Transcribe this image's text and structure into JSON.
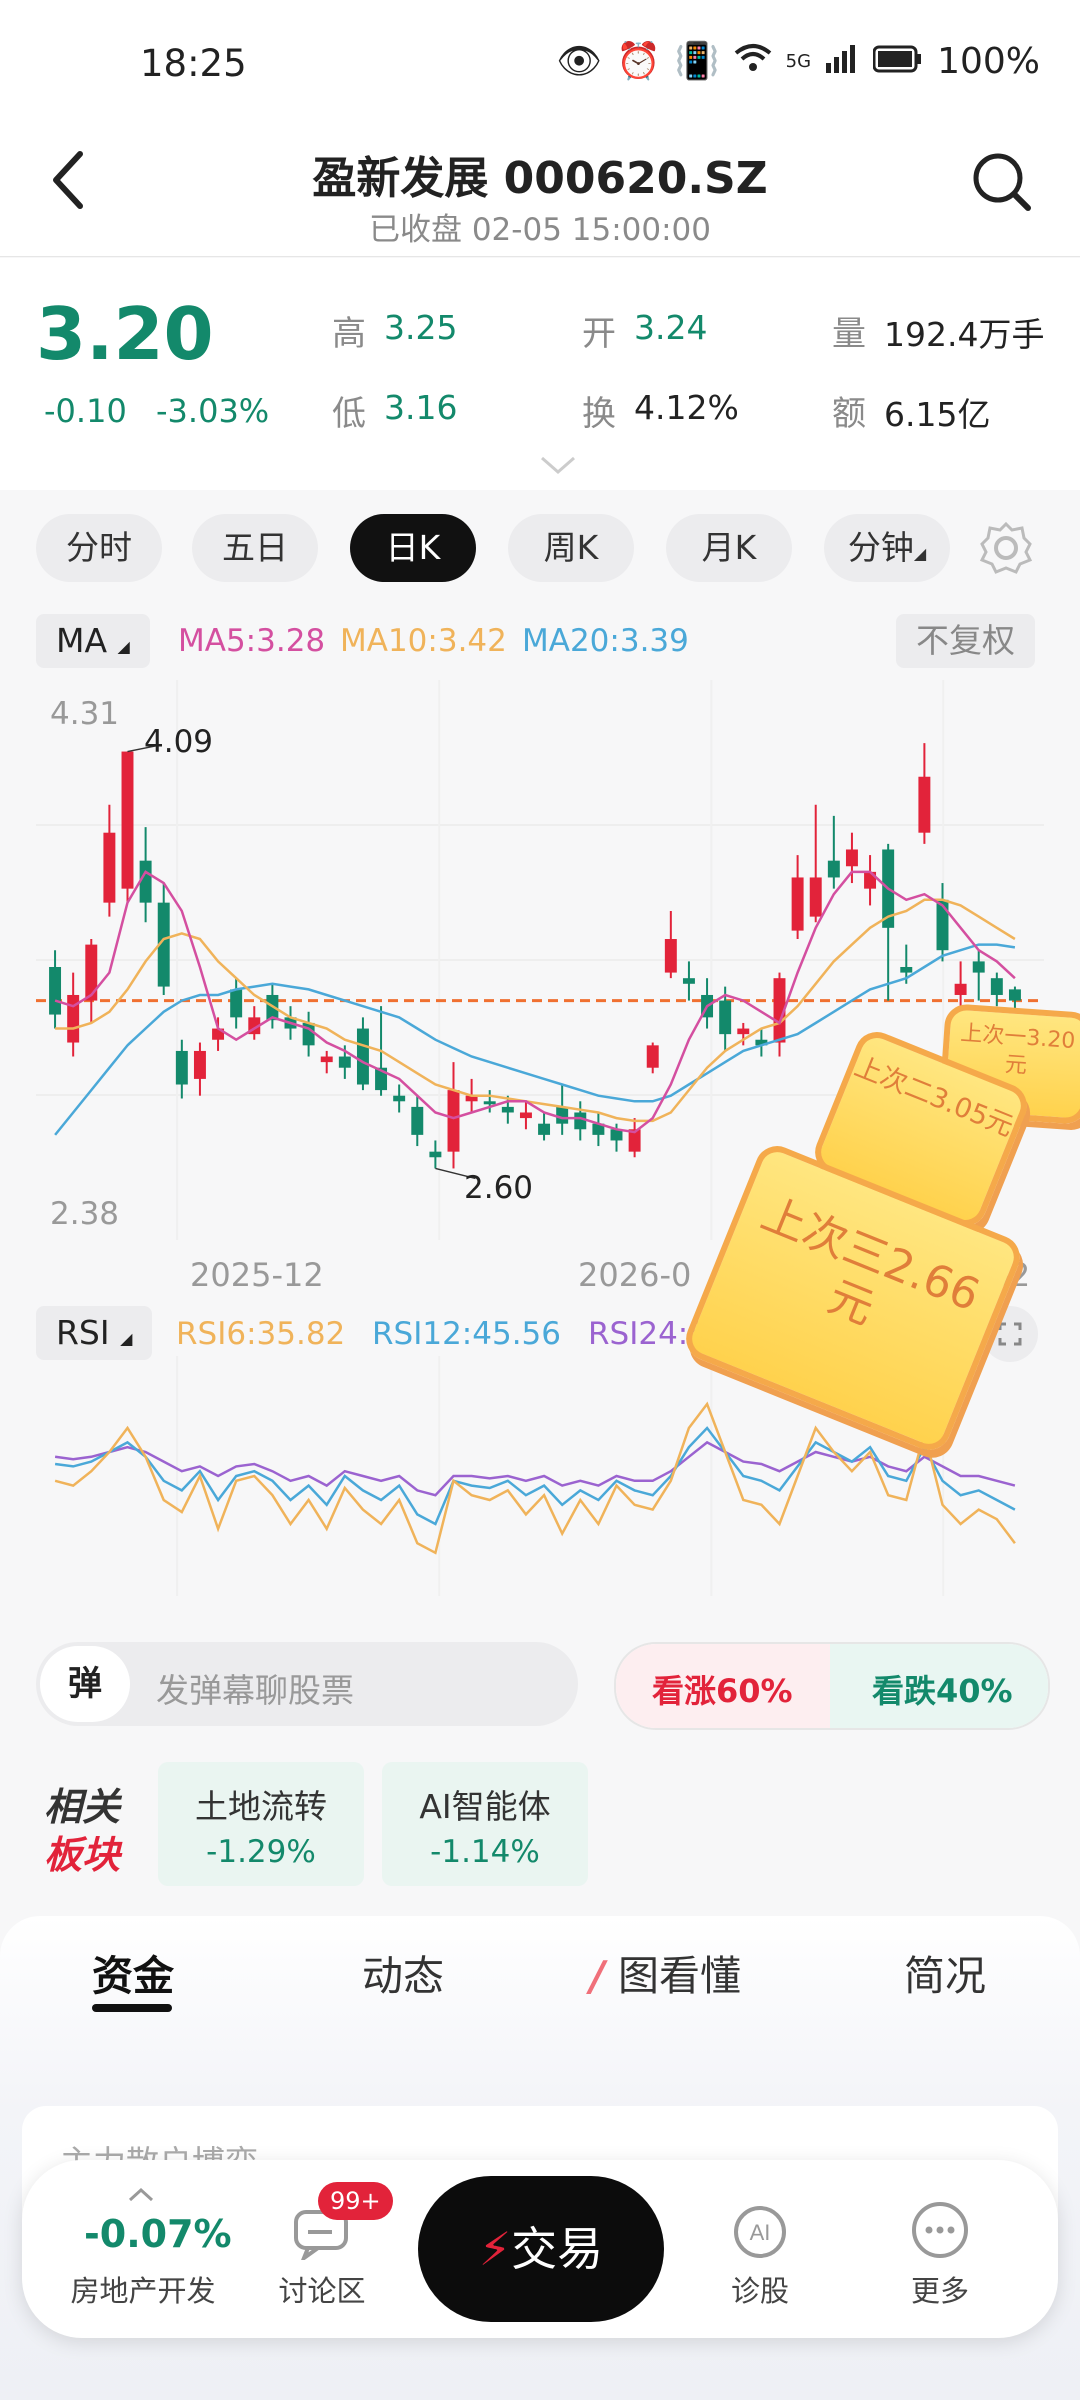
{
  "status": {
    "time": "18:25",
    "network": "5G",
    "battery": "100%"
  },
  "header": {
    "title": "盈新发展 000620.SZ",
    "subtitle": "已收盘 02-05 15:00:00"
  },
  "quote": {
    "price": "3.20",
    "change": "-0.10",
    "change_pct": "-3.03%",
    "high_label": "高",
    "high": "3.25",
    "low_label": "低",
    "low": "3.16",
    "open_label": "开",
    "open": "3.24",
    "turnover_label": "换",
    "turnover": "4.12%",
    "volume_label": "量",
    "volume": "192.4万手",
    "amount_label": "额",
    "amount": "6.15亿"
  },
  "periods": [
    {
      "label": "分时"
    },
    {
      "label": "五日"
    },
    {
      "label": "日K"
    },
    {
      "label": "周K"
    },
    {
      "label": "月K"
    },
    {
      "label": "分钟"
    }
  ],
  "ma": {
    "label": "MA",
    "ma5": "MA5:3.28",
    "ma10": "MA10:3.42",
    "ma20": "MA20:3.39",
    "adjust": "不复权"
  },
  "chart_labels": {
    "top": "4.31",
    "bottom": "2.38",
    "max": "4.09",
    "min": "2.60",
    "x1": "2025-12",
    "x2": "2026-0",
    "x3": "-02"
  },
  "rsi": {
    "label": "RSI",
    "rsi6": "RSI6:35.82",
    "rsi12": "RSI12:45.56",
    "rsi24": "RSI24:50."
  },
  "tags": {
    "t1": "上次一3.20元",
    "t2": "上次二3.05元",
    "t3": "上次三2.66元"
  },
  "danmu": {
    "toggle": "弹",
    "placeholder": "发弹幕聊股票"
  },
  "vote": {
    "up_label": "看涨",
    "up_pct": "60%",
    "down_label": "看跌",
    "down_pct": "40%"
  },
  "sectors": {
    "title_top": "相关",
    "title_bottom": "板块",
    "items": [
      {
        "name": "土地流转",
        "change": "-1.29%"
      },
      {
        "name": "AI智能体",
        "change": "-1.14%"
      }
    ]
  },
  "tabs": [
    {
      "label": "资金"
    },
    {
      "label": "动态"
    },
    {
      "label": "图看懂"
    },
    {
      "label": "简况"
    }
  ],
  "card": {
    "title": "主力散户博弈"
  },
  "nav": {
    "index_value": "-0.07%",
    "index_name": "房地产开发",
    "forum": "讨论区",
    "badge": "99+",
    "trade": "交易",
    "diagnose": "诊股",
    "more": "更多"
  },
  "colors": {
    "green": "#13896b",
    "red": "#e2233a",
    "ma5": "#d44fa0",
    "ma10": "#f0b35a",
    "ma20": "#4aa8d8",
    "rsi6": "#f0b35a",
    "rsi12": "#4aa8d8",
    "rsi24": "#9b63d0"
  },
  "chart_data": {
    "type": "candlestick",
    "ylim": [
      2.38,
      4.31
    ],
    "last_close": 3.2,
    "annotations": [
      "4.09",
      "2.60"
    ],
    "candles": [
      {
        "o": 3.32,
        "c": 3.15,
        "h": 3.38,
        "l": 3.1
      },
      {
        "o": 3.05,
        "c": 3.22,
        "h": 3.3,
        "l": 3.0
      },
      {
        "o": 3.2,
        "c": 3.4,
        "h": 3.42,
        "l": 3.12
      },
      {
        "o": 3.55,
        "c": 3.8,
        "h": 3.9,
        "l": 3.5
      },
      {
        "o": 3.6,
        "c": 4.09,
        "h": 4.09,
        "l": 3.55
      },
      {
        "o": 3.7,
        "c": 3.55,
        "h": 3.82,
        "l": 3.48
      },
      {
        "o": 3.55,
        "c": 3.25,
        "h": 3.62,
        "l": 3.22
      },
      {
        "o": 3.02,
        "c": 2.9,
        "h": 3.06,
        "l": 2.85
      },
      {
        "o": 2.92,
        "c": 3.02,
        "h": 3.05,
        "l": 2.86
      },
      {
        "o": 3.06,
        "c": 3.1,
        "h": 3.14,
        "l": 3.02
      },
      {
        "o": 3.24,
        "c": 3.14,
        "h": 3.28,
        "l": 3.1
      },
      {
        "o": 3.08,
        "c": 3.14,
        "h": 3.18,
        "l": 3.06
      },
      {
        "o": 3.22,
        "c": 3.13,
        "h": 3.26,
        "l": 3.1
      },
      {
        "o": 3.14,
        "c": 3.1,
        "h": 3.18,
        "l": 3.06
      },
      {
        "o": 3.12,
        "c": 3.04,
        "h": 3.16,
        "l": 3.0
      },
      {
        "o": 2.98,
        "c": 3.0,
        "h": 3.02,
        "l": 2.94
      },
      {
        "o": 3.0,
        "c": 2.96,
        "h": 3.04,
        "l": 2.92
      },
      {
        "o": 3.1,
        "c": 2.9,
        "h": 3.14,
        "l": 2.88
      },
      {
        "o": 2.96,
        "c": 2.88,
        "h": 3.18,
        "l": 2.86
      },
      {
        "o": 2.86,
        "c": 2.84,
        "h": 2.9,
        "l": 2.8
      },
      {
        "o": 2.82,
        "c": 2.72,
        "h": 2.86,
        "l": 2.68
      },
      {
        "o": 2.66,
        "c": 2.64,
        "h": 2.7,
        "l": 2.6
      },
      {
        "o": 2.66,
        "c": 2.88,
        "h": 2.98,
        "l": 2.6
      },
      {
        "o": 2.84,
        "c": 2.86,
        "h": 2.92,
        "l": 2.8
      },
      {
        "o": 2.84,
        "c": 2.83,
        "h": 2.88,
        "l": 2.8
      },
      {
        "o": 2.82,
        "c": 2.8,
        "h": 2.86,
        "l": 2.76
      },
      {
        "o": 2.78,
        "c": 2.8,
        "h": 2.84,
        "l": 2.74
      },
      {
        "o": 2.76,
        "c": 2.72,
        "h": 2.8,
        "l": 2.7
      },
      {
        "o": 2.82,
        "c": 2.76,
        "h": 2.9,
        "l": 2.72
      },
      {
        "o": 2.8,
        "c": 2.74,
        "h": 2.84,
        "l": 2.7
      },
      {
        "o": 2.76,
        "c": 2.72,
        "h": 2.8,
        "l": 2.68
      },
      {
        "o": 2.74,
        "c": 2.7,
        "h": 2.76,
        "l": 2.66
      },
      {
        "o": 2.66,
        "c": 2.74,
        "h": 2.78,
        "l": 2.64
      },
      {
        "o": 2.96,
        "c": 3.04,
        "h": 3.05,
        "l": 2.94
      },
      {
        "o": 3.3,
        "c": 3.42,
        "h": 3.52,
        "l": 3.28
      },
      {
        "o": 3.28,
        "c": 3.26,
        "h": 3.34,
        "l": 3.2
      },
      {
        "o": 3.22,
        "c": 3.14,
        "h": 3.28,
        "l": 3.1
      },
      {
        "o": 3.2,
        "c": 3.08,
        "h": 3.25,
        "l": 3.02
      },
      {
        "o": 3.08,
        "c": 3.1,
        "h": 3.12,
        "l": 3.04
      },
      {
        "o": 3.06,
        "c": 3.04,
        "h": 3.1,
        "l": 3.0
      },
      {
        "o": 3.05,
        "c": 3.28,
        "h": 3.3,
        "l": 3.0
      },
      {
        "o": 3.45,
        "c": 3.64,
        "h": 3.72,
        "l": 3.42
      },
      {
        "o": 3.5,
        "c": 3.64,
        "h": 3.9,
        "l": 3.48
      },
      {
        "o": 3.7,
        "c": 3.64,
        "h": 3.86,
        "l": 3.6
      },
      {
        "o": 3.68,
        "c": 3.74,
        "h": 3.8,
        "l": 3.62
      },
      {
        "o": 3.6,
        "c": 3.66,
        "h": 3.72,
        "l": 3.54
      },
      {
        "o": 3.74,
        "c": 3.46,
        "h": 3.76,
        "l": 3.2
      },
      {
        "o": 3.32,
        "c": 3.3,
        "h": 3.4,
        "l": 3.26
      },
      {
        "o": 3.8,
        "c": 4.0,
        "h": 4.12,
        "l": 3.76
      },
      {
        "o": 3.56,
        "c": 3.38,
        "h": 3.62,
        "l": 3.34
      },
      {
        "o": 3.22,
        "c": 3.26,
        "h": 3.34,
        "l": 3.18
      },
      {
        "o": 3.34,
        "c": 3.3,
        "h": 3.38,
        "l": 3.2
      },
      {
        "o": 3.28,
        "c": 3.22,
        "h": 3.3,
        "l": 3.18
      },
      {
        "o": 3.24,
        "c": 3.2,
        "h": 3.25,
        "l": 3.16
      }
    ],
    "ma5": [
      3.2,
      3.18,
      3.22,
      3.3,
      3.55,
      3.66,
      3.62,
      3.52,
      3.32,
      3.1,
      3.06,
      3.1,
      3.14,
      3.12,
      3.1,
      3.05,
      3.02,
      2.98,
      2.95,
      2.92,
      2.86,
      2.8,
      2.78,
      2.8,
      2.82,
      2.84,
      2.84,
      2.8,
      2.78,
      2.78,
      2.76,
      2.74,
      2.73,
      2.78,
      2.9,
      3.06,
      3.18,
      3.22,
      3.2,
      3.16,
      3.12,
      3.3,
      3.46,
      3.58,
      3.66,
      3.66,
      3.6,
      3.56,
      3.58,
      3.54,
      3.46,
      3.38,
      3.34,
      3.28
    ],
    "ma10": [
      3.1,
      3.1,
      3.12,
      3.16,
      3.24,
      3.34,
      3.42,
      3.44,
      3.42,
      3.34,
      3.28,
      3.22,
      3.18,
      3.14,
      3.12,
      3.1,
      3.06,
      3.04,
      3.02,
      2.98,
      2.94,
      2.9,
      2.88,
      2.86,
      2.86,
      2.85,
      2.84,
      2.83,
      2.82,
      2.81,
      2.8,
      2.78,
      2.77,
      2.77,
      2.8,
      2.88,
      2.96,
      3.02,
      3.06,
      3.1,
      3.12,
      3.18,
      3.26,
      3.34,
      3.4,
      3.46,
      3.5,
      3.52,
      3.56,
      3.56,
      3.54,
      3.5,
      3.46,
      3.42
    ],
    "ma20": [
      2.72,
      2.8,
      2.88,
      2.96,
      3.04,
      3.1,
      3.16,
      3.2,
      3.22,
      3.22,
      3.24,
      3.25,
      3.26,
      3.25,
      3.24,
      3.22,
      3.2,
      3.18,
      3.16,
      3.14,
      3.1,
      3.06,
      3.03,
      3.0,
      2.98,
      2.96,
      2.94,
      2.92,
      2.9,
      2.88,
      2.86,
      2.85,
      2.84,
      2.84,
      2.86,
      2.9,
      2.94,
      2.98,
      3.02,
      3.04,
      3.06,
      3.08,
      3.12,
      3.16,
      3.2,
      3.24,
      3.26,
      3.28,
      3.32,
      3.36,
      3.38,
      3.4,
      3.4,
      3.39
    ],
    "rsi": {
      "ylim": [
        0,
        100
      ],
      "rsi6": [
        48,
        46,
        52,
        60,
        70,
        58,
        40,
        35,
        50,
        28,
        48,
        50,
        42,
        30,
        40,
        28,
        45,
        36,
        30,
        40,
        22,
        18,
        48,
        42,
        40,
        44,
        34,
        42,
        26,
        40,
        30,
        46,
        38,
        36,
        48,
        70,
        80,
        60,
        40,
        38,
        30,
        50,
        70,
        60,
        52,
        60,
        42,
        40,
        68,
        38,
        30,
        36,
        32,
        22
      ],
      "rsi12": [
        55,
        54,
        56,
        60,
        64,
        58,
        48,
        44,
        52,
        40,
        50,
        52,
        48,
        40,
        46,
        38,
        50,
        44,
        40,
        46,
        34,
        30,
        48,
        46,
        45,
        48,
        42,
        46,
        38,
        44,
        40,
        48,
        44,
        42,
        50,
        62,
        70,
        60,
        50,
        48,
        44,
        54,
        64,
        60,
        56,
        62,
        50,
        48,
        62,
        48,
        42,
        44,
        40,
        36
      ],
      "rsi24": [
        58,
        57,
        58,
        60,
        62,
        60,
        56,
        52,
        54,
        50,
        54,
        55,
        52,
        48,
        50,
        46,
        52,
        50,
        48,
        50,
        44,
        42,
        50,
        50,
        49,
        50,
        48,
        50,
        46,
        48,
        46,
        50,
        48,
        48,
        52,
        58,
        64,
        60,
        56,
        55,
        52,
        56,
        60,
        58,
        56,
        58,
        54,
        52,
        58,
        54,
        50,
        50,
        48,
        46
      ]
    }
  }
}
